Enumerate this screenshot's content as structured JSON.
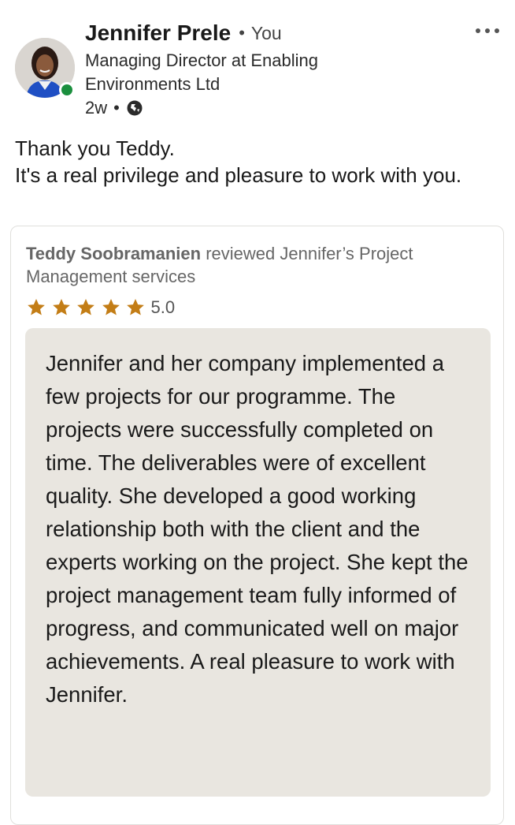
{
  "post": {
    "author_name": "Jennifer Prele",
    "author_relation": "You",
    "headline": "Managing Director at Enabling Environments Ltd",
    "time_ago": "2w",
    "body_lines": [
      "Thank you Teddy.",
      "It's a real privilege and pleasure to work with you."
    ]
  },
  "review": {
    "reviewer_name": "Teddy Soobramanien",
    "review_text": "reviewed Jennifer’s Project Management services",
    "stars": 5,
    "rating_value": "5.0",
    "quote": "Jennifer and her company implemented a few projects for our programme. The projects were successfully completed on time. The deliverables were of excellent quality. She developed a good working relationship both with the client and the experts working on the project. She kept the project management team fully informed  of progress, and communicated  well on major achievements. A real pleasure to work with Jennifer."
  },
  "colors": {
    "star": "#c37d16",
    "online": "#1b8f3e",
    "quote_background": "#e9e6e0",
    "secondary_text": "#666666"
  },
  "icons": {
    "more": "more-horizontal-icon",
    "visibility": "globe-icon",
    "rating": "star-icon"
  }
}
